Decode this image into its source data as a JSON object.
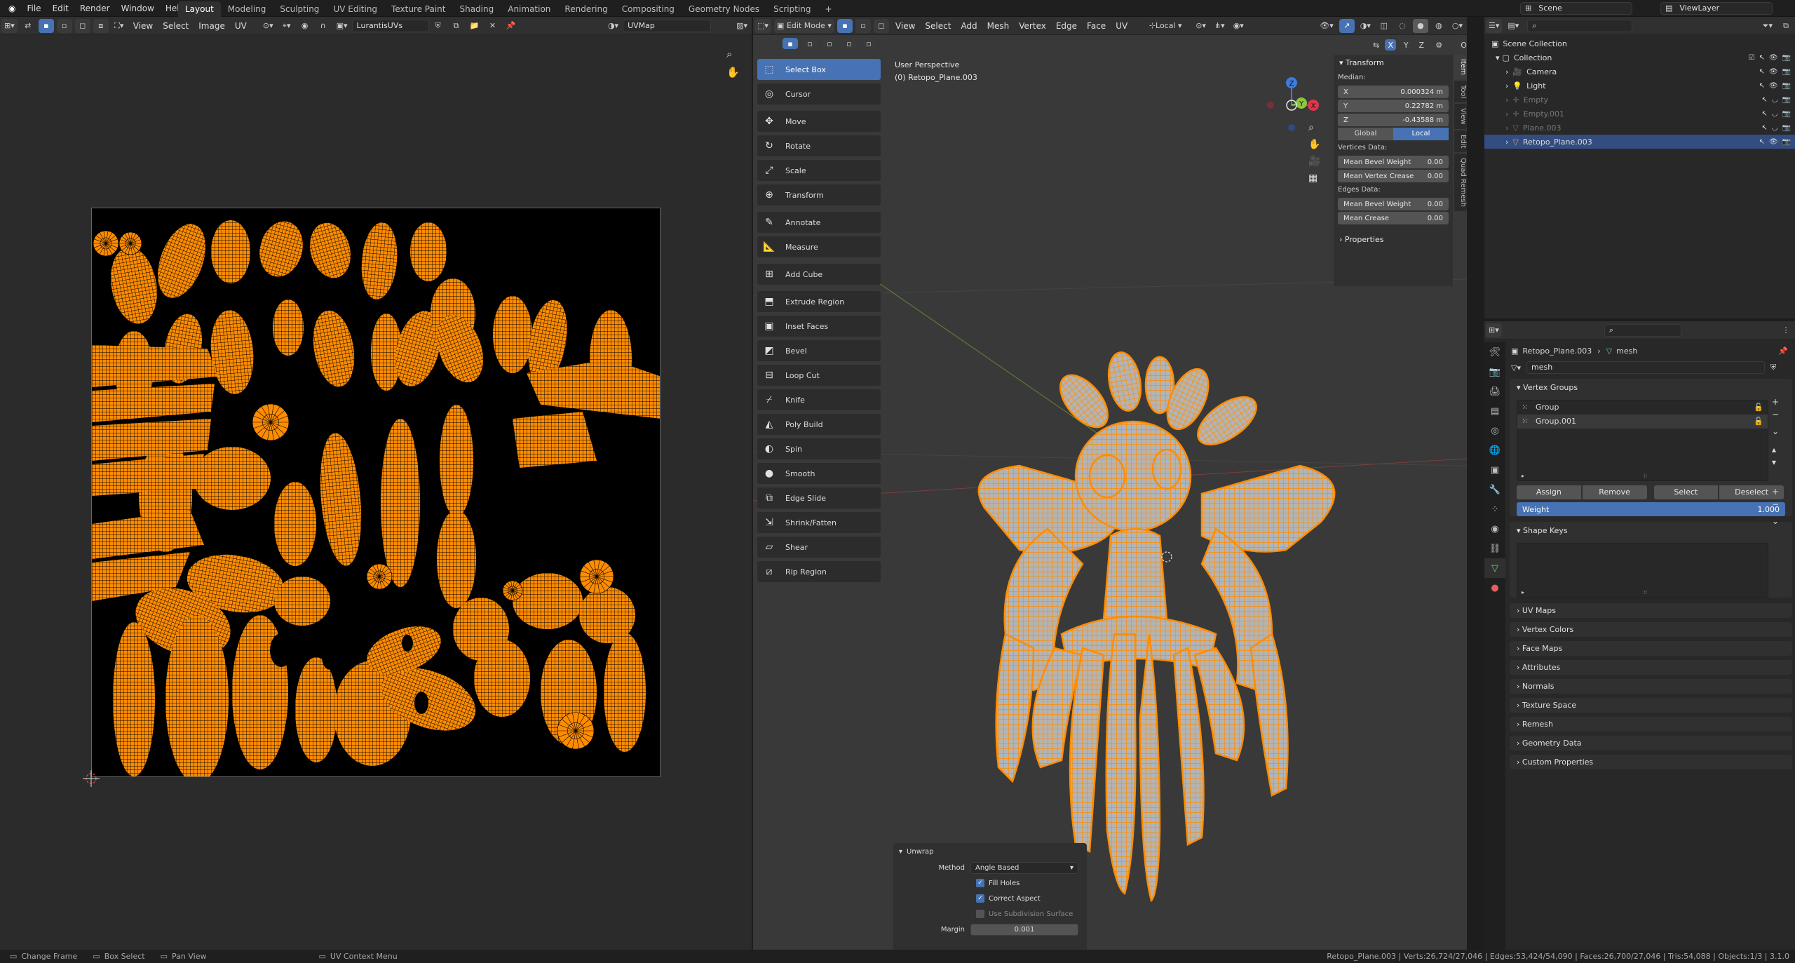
{
  "app": {
    "menus": [
      "File",
      "Edit",
      "Render",
      "Window",
      "Help"
    ],
    "workspaces": [
      "Layout",
      "Modeling",
      "Sculpting",
      "UV Editing",
      "Texture Paint",
      "Shading",
      "Animation",
      "Rendering",
      "Compositing",
      "Geometry Nodes",
      "Scripting"
    ],
    "active_workspace": "Layout",
    "scene": "Scene",
    "view_layer": "ViewLayer"
  },
  "uv_editor": {
    "menus": [
      "View",
      "Select",
      "Image",
      "UV"
    ],
    "image_name": "LurantisUVs",
    "uv_map": "UVMap",
    "wire_color": "#ff8c00"
  },
  "viewport": {
    "mode": "Edit Mode",
    "menus": [
      "View",
      "Select",
      "Add",
      "Mesh",
      "Vertex",
      "Edge",
      "Face",
      "UV"
    ],
    "orientation": "Local",
    "options_label": "Options",
    "xyz_labels": [
      "X",
      "Y",
      "Z"
    ],
    "info_line1": "User Perspective",
    "info_line2": "(0) Retopo_Plane.003",
    "tools": [
      {
        "label": "Select Box",
        "icon": "select-box-icon",
        "glyph": "⬚",
        "active": true
      },
      {
        "label": "Cursor",
        "icon": "cursor-icon",
        "glyph": "◎"
      },
      {
        "label": "Move",
        "icon": "move-icon",
        "glyph": "✥"
      },
      {
        "label": "Rotate",
        "icon": "rotate-icon",
        "glyph": "↻"
      },
      {
        "label": "Scale",
        "icon": "scale-icon",
        "glyph": "⤢"
      },
      {
        "label": "Transform",
        "icon": "transform-icon",
        "glyph": "⊕"
      },
      {
        "label": "Annotate",
        "icon": "annotate-icon",
        "glyph": "✎"
      },
      {
        "label": "Measure",
        "icon": "measure-icon",
        "glyph": "📐"
      },
      {
        "label": "Add Cube",
        "icon": "add-cube-icon",
        "glyph": "⊞"
      },
      {
        "label": "Extrude Region",
        "icon": "extrude-region-icon",
        "glyph": "⬒"
      },
      {
        "label": "Inset Faces",
        "icon": "inset-faces-icon",
        "glyph": "▣"
      },
      {
        "label": "Bevel",
        "icon": "bevel-icon",
        "glyph": "◩"
      },
      {
        "label": "Loop Cut",
        "icon": "loop-cut-icon",
        "glyph": "⊟"
      },
      {
        "label": "Knife",
        "icon": "knife-icon",
        "glyph": "⌿"
      },
      {
        "label": "Poly Build",
        "icon": "poly-build-icon",
        "glyph": "◭"
      },
      {
        "label": "Spin",
        "icon": "spin-icon",
        "glyph": "◐"
      },
      {
        "label": "Smooth",
        "icon": "smooth-icon",
        "glyph": "●"
      },
      {
        "label": "Edge Slide",
        "icon": "edge-slide-icon",
        "glyph": "⧉"
      },
      {
        "label": "Shrink/Fatten",
        "icon": "shrink-fatten-icon",
        "glyph": "⇲"
      },
      {
        "label": "Shear",
        "icon": "shear-icon",
        "glyph": "▱"
      },
      {
        "label": "Rip Region",
        "icon": "rip-region-icon",
        "glyph": "⧄"
      }
    ],
    "gizmo_axes": {
      "x": "X",
      "y": "Y",
      "z": "Z",
      "x_color": "#e0364c",
      "y_color": "#8cc63f",
      "z_color": "#3d7ce0"
    }
  },
  "npanel": {
    "tabs": [
      "Item",
      "Tool",
      "View",
      "Edit",
      "Quad Remesh"
    ],
    "transform_title": "Transform",
    "median_label": "Median:",
    "x_label": "X",
    "x_value": "0.000324 m",
    "y_label": "Y",
    "y_value": "0.22782 m",
    "z_label": "Z",
    "z_value": "-0.43588 m",
    "global_label": "Global",
    "local_label": "Local",
    "vertices_data_label": "Vertices Data:",
    "mean_bevel_weight_label": "Mean Bevel Weight",
    "mean_bevel_weight_v": "0.00",
    "mean_vertex_crease_label": "Mean Vertex Crease",
    "mean_vertex_crease_v": "0.00",
    "edges_data_label": "Edges Data:",
    "edge_bevel_weight_label": "Mean Bevel Weight",
    "edge_bevel_weight_v": "0.00",
    "mean_crease_label": "Mean Crease",
    "mean_crease_v": "0.00",
    "properties_label": "Properties"
  },
  "unwrap_panel": {
    "title": "Unwrap",
    "method_label": "Method",
    "method_value": "Angle Based",
    "fill_holes": "Fill Holes",
    "correct_aspect": "Correct Aspect",
    "use_subdivision": "Use Subdivision Surface",
    "margin_label": "Margin",
    "margin_value": "0.001"
  },
  "outliner": {
    "root": "Scene Collection",
    "collection": "Collection",
    "items": [
      {
        "label": "Camera",
        "dim": false,
        "selected": false
      },
      {
        "label": "Light",
        "dim": false,
        "selected": false
      },
      {
        "label": "Empty",
        "dim": true,
        "selected": false
      },
      {
        "label": "Empty.001",
        "dim": true,
        "selected": false
      },
      {
        "label": "Plane.003",
        "dim": true,
        "selected": false
      },
      {
        "label": "Retopo_Plane.003",
        "dim": false,
        "selected": true
      }
    ]
  },
  "properties": {
    "breadcrumb_object": "Retopo_Plane.003",
    "breadcrumb_data": "mesh",
    "mesh_name": "mesh",
    "vertex_groups_title": "Vertex Groups",
    "vertex_groups": [
      "Group",
      "Group.001"
    ],
    "assign": "Assign",
    "remove": "Remove",
    "select": "Select",
    "deselect": "Deselect",
    "weight_label": "Weight",
    "weight_value": "1.000",
    "shape_keys_title": "Shape Keys",
    "collapsed_sections": [
      "UV Maps",
      "Vertex Colors",
      "Face Maps",
      "Attributes",
      "Normals",
      "Texture Space",
      "Remesh",
      "Geometry Data",
      "Custom Properties"
    ]
  },
  "statusbar": {
    "hint1": "Change Frame",
    "hint2": "Box Select",
    "hint3": "Pan View",
    "hint4": "UV Context Menu",
    "stats": "Retopo_Plane.003 | Verts:26,724/27,046 | Edges:53,424/54,090 | Faces:26,700/27,046 | Tris:54,088 | Objects:1/3 | 3.1.0"
  }
}
